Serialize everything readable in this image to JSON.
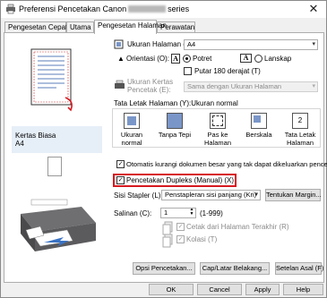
{
  "window": {
    "title_prefix": "Preferensi Pencetakan Canon",
    "title_suffix": "series",
    "close": "✕"
  },
  "tabs": [
    {
      "label": "Pengesetan Cepat"
    },
    {
      "label": "Utama"
    },
    {
      "label": "Pengesetan Halaman"
    },
    {
      "label": "Perawatan"
    }
  ],
  "preview": {
    "media_label": "Kertas Biasa",
    "size_label": "A4"
  },
  "page_setup": {
    "page_size_label": "Ukuran Halaman (Z):",
    "page_size_value": "A4",
    "orientation_label": "Orientasi (O):",
    "portrait": "Potret",
    "landscape": "Lanskap",
    "rotate180": "Putar 180 derajat (T)",
    "paper_size_label_1": "Ukuran Kertas",
    "paper_size_label_2": "Pencetak (E):",
    "paper_size_value": "Sama dengan Ukuran Halaman"
  },
  "layout": {
    "label": "Tata Letak Halaman (Y):Ukuran normal",
    "options": [
      {
        "label": "Ukuran normal"
      },
      {
        "label": "Tanpa Tepi"
      },
      {
        "label": "Pas ke Halaman"
      },
      {
        "label": "Berskala"
      },
      {
        "label": "Tata Letak Halaman"
      }
    ]
  },
  "auto_reduce": {
    "label": "Otomatis kurangi dokumen besar yang tak dapat dikeluarkan pencetak",
    "checked": true
  },
  "duplex": {
    "label": "Pencetakan Dupleks (Manual) (X)",
    "checked": true
  },
  "stapling": {
    "label": "Sisi Stapler (L):",
    "value": "Penstapleran sisi panjang (Kri)",
    "margin_button": "Tentukan Margin..."
  },
  "copies": {
    "label": "Salinan (C):",
    "value": "1",
    "range": "(1-999)",
    "last_page_first": "Cetak dari Halaman Terakhir (R)",
    "collate": "Kolasi (T)"
  },
  "bottom_buttons": {
    "print_options": "Opsi Pencetakan...",
    "stamp_background": "Cap/Latar Belakang...",
    "defaults": "Setelan Asal (F)"
  },
  "dialog_buttons": {
    "ok": "OK",
    "cancel": "Cancel",
    "apply": "Apply",
    "help": "Help"
  }
}
